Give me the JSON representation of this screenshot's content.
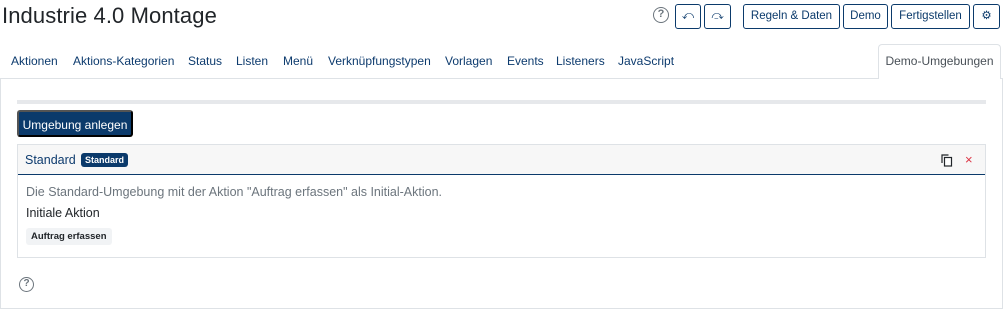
{
  "page": {
    "title": "Industrie 4.0 Montage"
  },
  "toolbar": {
    "help_glyph": "?",
    "undo_glyph": "⤺",
    "redo_glyph": "⤼",
    "rules_label": "Regeln & Daten",
    "demo_label": "Demo",
    "finish_label": "Fertigstellen",
    "settings_glyph": "⚙"
  },
  "tabs": [
    {
      "label": "Aktionen"
    },
    {
      "label": "Aktions-Kategorien"
    },
    {
      "label": "Status"
    },
    {
      "label": "Listen"
    },
    {
      "label": "Menü"
    },
    {
      "label": "Verknüpfungstypen"
    },
    {
      "label": "Vorlagen"
    },
    {
      "label": "Events"
    },
    {
      "label": "Listeners"
    },
    {
      "label": "JavaScript"
    },
    {
      "label": "Demo-Umgebungen",
      "active": true
    }
  ],
  "main": {
    "create_button": "Umgebung anlegen",
    "environment": {
      "name": "Standard",
      "badge": "Standard",
      "description": "Die Standard-Umgebung mit der Aktion \"Auftrag erfassen\" als Initial-Aktion.",
      "initial_label": "Initiale Aktion",
      "initial_action": "Auftrag erfassen",
      "delete_glyph": "×"
    },
    "help_glyph": "?"
  },
  "colors": {
    "primary": "#0b3a6b",
    "danger": "#dc3545",
    "muted": "#6c757d"
  }
}
